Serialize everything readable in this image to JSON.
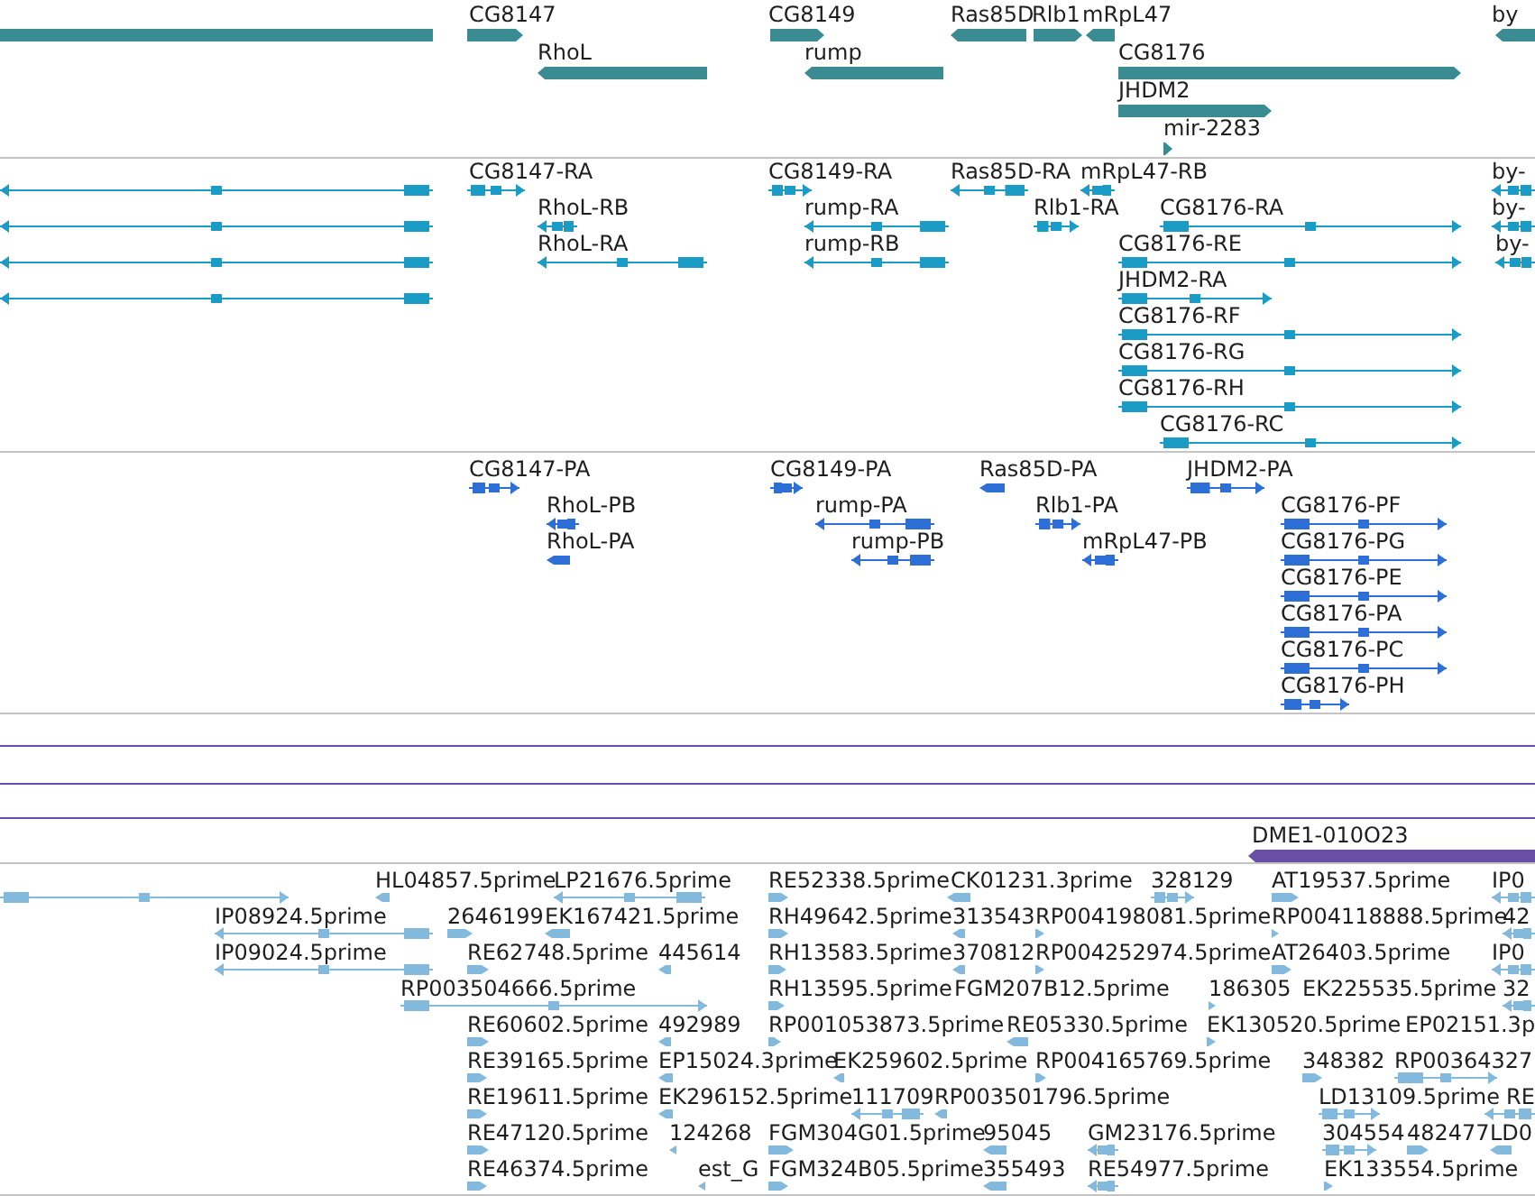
{
  "tracks": [
    {
      "kind": "gene",
      "features": [
        {
          "label": "CG8147"
        },
        {
          "label": "CG8149"
        },
        {
          "label": "Ras85D"
        },
        {
          "label": "Rlb1"
        },
        {
          "label": "mRpL47"
        },
        {
          "label": "by"
        },
        {
          "label": "RhoL"
        },
        {
          "label": "rump"
        },
        {
          "label": "CG8176"
        },
        {
          "label": "JHDM2"
        },
        {
          "label": "mir-2283"
        }
      ]
    },
    {
      "kind": "transcript",
      "features": [
        {
          "label": "CG8147-RA"
        },
        {
          "label": "CG8149-RA"
        },
        {
          "label": "Ras85D-RA"
        },
        {
          "label": "mRpL47-RB"
        },
        {
          "label": "by-"
        },
        {
          "label": "RhoL-RB"
        },
        {
          "label": "rump-RA"
        },
        {
          "label": "Rlb1-RA"
        },
        {
          "label": "CG8176-RA"
        },
        {
          "label": "by-"
        },
        {
          "label": "RhoL-RA"
        },
        {
          "label": "rump-RB"
        },
        {
          "label": "CG8176-RE"
        },
        {
          "label": "by-"
        },
        {
          "label": "JHDM2-RA"
        },
        {
          "label": "CG8176-RF"
        },
        {
          "label": "CG8176-RG"
        },
        {
          "label": "CG8176-RH"
        },
        {
          "label": "CG8176-RC"
        }
      ]
    },
    {
      "kind": "protein",
      "features": [
        {
          "label": "CG8147-PA"
        },
        {
          "label": "CG8149-PA"
        },
        {
          "label": "Ras85D-PA"
        },
        {
          "label": "JHDM2-PA"
        },
        {
          "label": "RhoL-PB"
        },
        {
          "label": "rump-PA"
        },
        {
          "label": "Rlb1-PA"
        },
        {
          "label": "CG8176-PF"
        },
        {
          "label": "RhoL-PA"
        },
        {
          "label": "rump-PB"
        },
        {
          "label": "mRpL47-PB"
        },
        {
          "label": "CG8176-PG"
        },
        {
          "label": "CG8176-PE"
        },
        {
          "label": "CG8176-PA"
        },
        {
          "label": "CG8176-PC"
        },
        {
          "label": "CG8176-PH"
        }
      ]
    },
    {
      "kind": "clone",
      "features": [
        {
          "label": "DME1-010O23"
        }
      ]
    },
    {
      "kind": "est",
      "features": [
        {
          "label": "HL04857.5prime"
        },
        {
          "label": "LP21676.5prime"
        },
        {
          "label": "RE52338.5prime"
        },
        {
          "label": "CK01231.3prime"
        },
        {
          "label": "328129"
        },
        {
          "label": "AT19537.5prime"
        },
        {
          "label": "IP0"
        },
        {
          "label": "IP08924.5prime"
        },
        {
          "label": "2646199"
        },
        {
          "label": "EK167421.5prime"
        },
        {
          "label": "RH49642.5prime"
        },
        {
          "label": "313543"
        },
        {
          "label": "RP004198081.5prime"
        },
        {
          "label": "RP004118888.5prime"
        },
        {
          "label": "42"
        },
        {
          "label": "IP09024.5prime"
        },
        {
          "label": "RE62748.5prime"
        },
        {
          "label": "445614"
        },
        {
          "label": "RH13583.5prime"
        },
        {
          "label": "370812"
        },
        {
          "label": "RP004252974.5prime"
        },
        {
          "label": "AT26403.5prime"
        },
        {
          "label": "IP0"
        },
        {
          "label": "RP003504666.5prime"
        },
        {
          "label": "RH13595.5prime"
        },
        {
          "label": "FGM207B12.5prime"
        },
        {
          "label": "186305"
        },
        {
          "label": "EK225535.5prime"
        },
        {
          "label": "32"
        },
        {
          "label": "RE60602.5prime"
        },
        {
          "label": "492989"
        },
        {
          "label": "RP001053873.5prime"
        },
        {
          "label": "RE05330.5prime"
        },
        {
          "label": "EK130520.5prime"
        },
        {
          "label": "EP02151.3p"
        },
        {
          "label": "RE39165.5prime"
        },
        {
          "label": "EP15024.3prime"
        },
        {
          "label": "EK259602.5prime"
        },
        {
          "label": "RP004165769.5prime"
        },
        {
          "label": "348382"
        },
        {
          "label": "RP00364327"
        },
        {
          "label": "RE19611.5prime"
        },
        {
          "label": "EK296152.5prime"
        },
        {
          "label": "111709"
        },
        {
          "label": "RP003501796.5prime"
        },
        {
          "label": "LD13109.5prime"
        },
        {
          "label": "RE"
        },
        {
          "label": "RE47120.5prime"
        },
        {
          "label": "124268"
        },
        {
          "label": "FGM304G01.5prime"
        },
        {
          "label": "95045"
        },
        {
          "label": "GM23176.5prime"
        },
        {
          "label": "304554"
        },
        {
          "label": "482477"
        },
        {
          "label": "LD0"
        },
        {
          "label": "RE46374.5prime"
        },
        {
          "label": "est_G"
        },
        {
          "label": "FGM324B05.5prime"
        },
        {
          "label": "355493"
        },
        {
          "label": "RE54977.5prime"
        },
        {
          "label": "EK133554.5prime"
        }
      ]
    }
  ]
}
